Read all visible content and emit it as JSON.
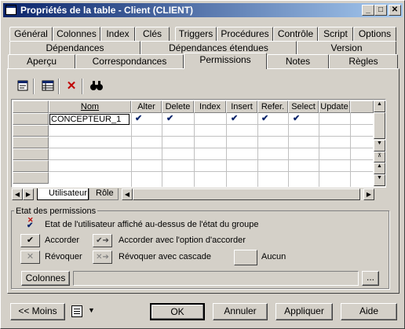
{
  "window": {
    "title": "Propriétés de la table - Client (CLIENT)",
    "controls": {
      "minimize": "_",
      "maximize": "□",
      "close": "✕"
    }
  },
  "tabs": {
    "row1": [
      "Général",
      "Colonnes",
      "Index",
      "Clés",
      "Triggers",
      "Procédures",
      "Contrôle",
      "Script",
      "Options"
    ],
    "row2": [
      "Dépendances",
      "Dépendances étendues",
      "Version"
    ],
    "row3": [
      "Aperçu",
      "Correspondances",
      "Permissions",
      "Notes",
      "Règles"
    ],
    "active": "Permissions"
  },
  "toolbar": {
    "icons": [
      "properties-icon",
      "add-rows-icon",
      "delete-icon",
      "find-icon"
    ]
  },
  "grid": {
    "columns": [
      "Nom",
      "Alter",
      "Delete",
      "Index",
      "Insert",
      "Refer.",
      "Select",
      "Update"
    ],
    "rows": [
      {
        "nom": "CONCEPTEUR_1",
        "alter": "✔",
        "delete": "✔",
        "index": "",
        "insert": "✔",
        "refer": "✔",
        "select": "✔",
        "update": ""
      }
    ]
  },
  "subtabs": [
    "Utilisateur",
    "Rôle"
  ],
  "permissions": {
    "legend": "Etat des permissions",
    "info": "Etat de l'utilisateur affiché au-dessus de l'état du groupe",
    "accorder": "Accorder",
    "accorder_option": "Accorder avec l'option d'accorder",
    "revoquer": "Révoquer",
    "revoquer_cascade": "Révoquer avec cascade",
    "aucun": "Aucun",
    "colonnes_button": "Colonnes",
    "colonnes_value": "",
    "ellipsis": "..."
  },
  "footer": {
    "moins": "<< Moins",
    "ok": "OK",
    "annuler": "Annuler",
    "appliquer": "Appliquer",
    "aide": "Aide"
  }
}
